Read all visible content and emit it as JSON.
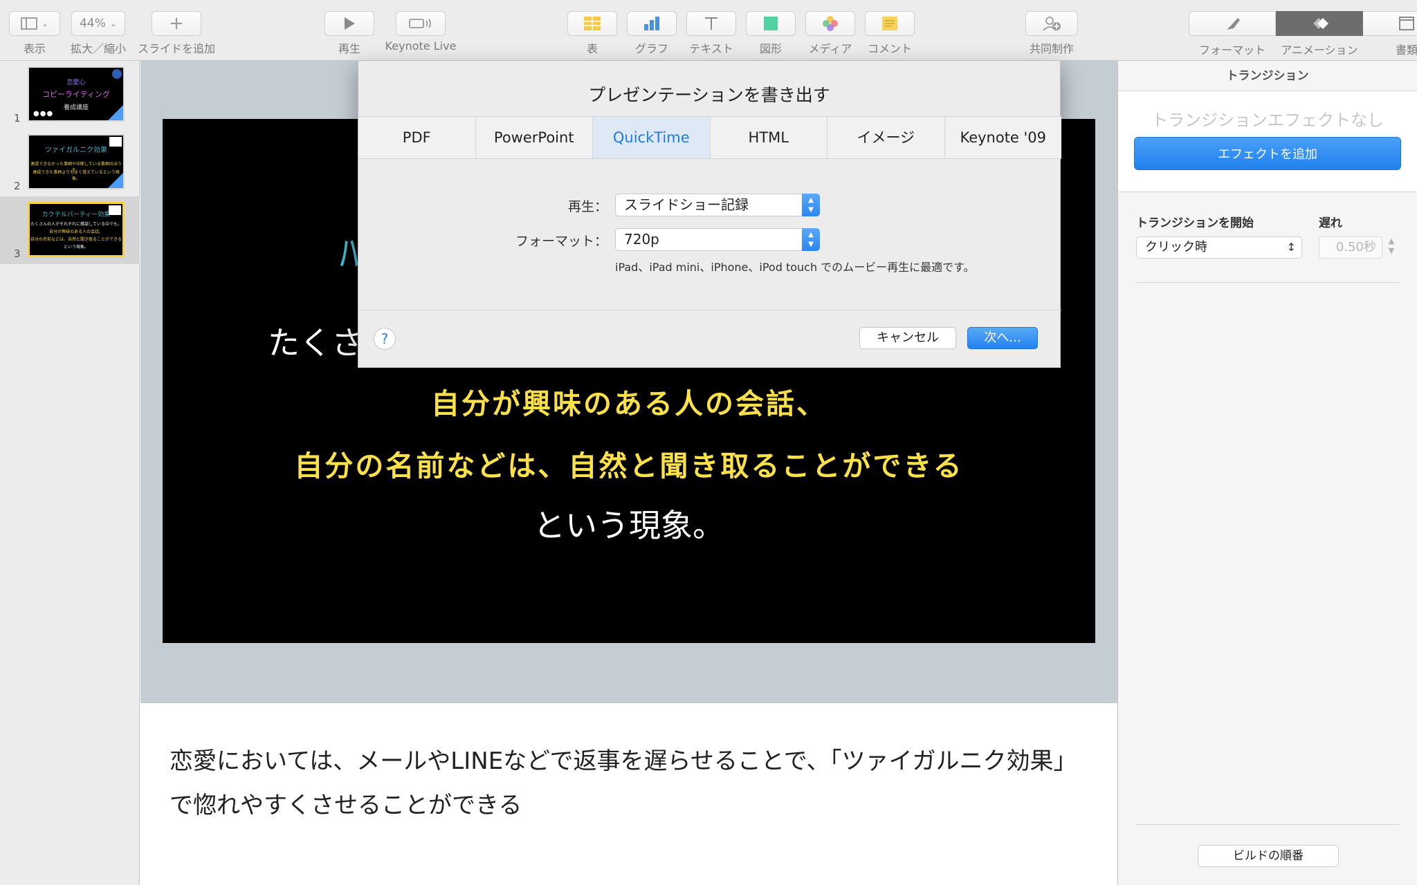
{
  "toolbar": {
    "view": "表示",
    "zoom_value": "44%",
    "zoom": "拡大／縮小",
    "add_slide": "スライドを追加",
    "play": "再生",
    "keynote_live": "Keynote Live",
    "table": "表",
    "chart": "グラフ",
    "text": "テキスト",
    "shape": "図形",
    "media": "メディア",
    "comment": "コメント",
    "collaborate": "共同制作",
    "format": "フォーマット",
    "animate": "アニメーション",
    "document": "書類"
  },
  "navigator": {
    "slides": [
      {
        "number": "1",
        "lines": [
          "恋愛心",
          "コピーライティング",
          "養成講座"
        ]
      },
      {
        "number": "2",
        "lines": [
          "ツァイガルニク効果",
          "達成できなかった事柄や中断している事柄のほうを、",
          "達成できた事柄よりもよく覚えているという現象。"
        ]
      },
      {
        "number": "3",
        "lines": [
          "カクテルパーティー効果",
          "たくさんの人がそれぞれに雑談している中でも、",
          "自分が興味のある人の会話、",
          "自分の名前などは、自然と聞き取ることができる",
          "という現象。"
        ]
      }
    ]
  },
  "slide": {
    "partial_line": "たくさ",
    "line_yellow_1": "自分が興味のある人の会話、",
    "line_yellow_2": "自分の名前などは、自然と聞き取ることができる",
    "line_white": "という現象。"
  },
  "notes": {
    "text": "恋愛においては、メールやLINEなどで返事を遅らせることで、「ツァイガルニク効果」で惚れやすくさせることができる"
  },
  "inspector": {
    "header": "トランジション",
    "no_effect": "トランジションエフェクトなし",
    "add_effect": "エフェクトを追加",
    "start_label": "トランジションを開始",
    "start_value": "クリック時",
    "delay_label": "遅れ",
    "delay_value": "0.50秒",
    "build_order": "ビルドの順番"
  },
  "export_sheet": {
    "title": "プレゼンテーションを書き出す",
    "tabs": [
      "PDF",
      "PowerPoint",
      "QuickTime",
      "HTML",
      "イメージ",
      "Keynote '09"
    ],
    "active_tab": "QuickTime",
    "playback_label": "再生：",
    "playback_value": "スライドショー記録",
    "format_label": "フォーマット：",
    "format_value": "720p",
    "format_description": "iPad、iPad mini、iPhone、iPod touch でのムービー再生に最適です。",
    "help": "?",
    "cancel": "キャンセル",
    "next": "次へ..."
  },
  "colors": {
    "accent_blue": "#1e7ae8",
    "slide_yellow": "#fae14a",
    "canvas_bg": "#c4ccd4"
  }
}
